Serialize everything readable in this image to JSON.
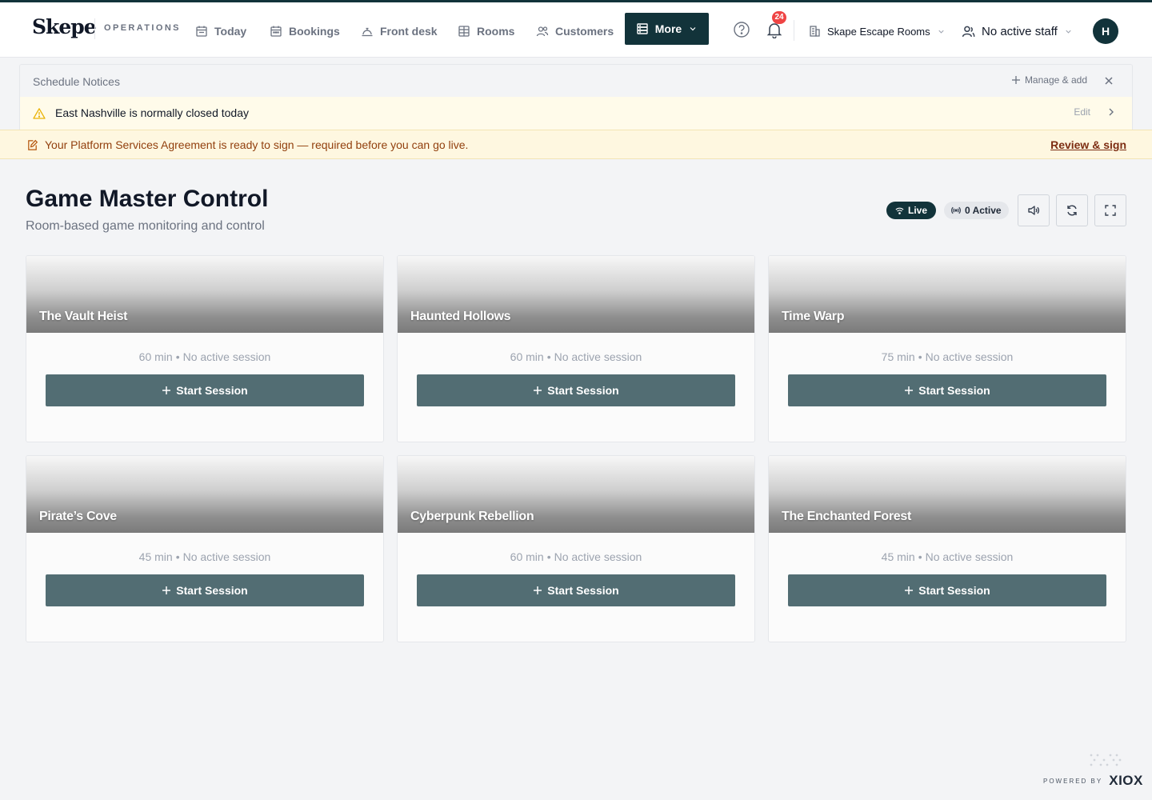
{
  "nav": {
    "logo": "Skepe",
    "section": "OPERATIONS",
    "items": [
      {
        "label": "Today",
        "icon": "calendar-day-icon"
      },
      {
        "label": "Bookings",
        "icon": "calendar-icon"
      },
      {
        "label": "Front desk",
        "icon": "bell-desk-icon"
      },
      {
        "label": "Rooms",
        "icon": "grid-icon"
      },
      {
        "label": "Customers",
        "icon": "users-icon"
      }
    ],
    "more_label": "More",
    "notification_count": "24",
    "org_name": "Skape Escape Rooms",
    "staff_label": "No active staff",
    "avatar_initial": "H"
  },
  "notices": {
    "title": "Schedule Notices",
    "manage_label": "Manage & add",
    "items": [
      {
        "text": "East Nashville is normally closed today",
        "action": "Edit"
      }
    ]
  },
  "agreement": {
    "text": "Your Platform Services Agreement is ready to sign — required before you can go live.",
    "link_label": "Review & sign"
  },
  "header": {
    "title": "Game Master Control",
    "subtitle": "Room-based game monitoring and control",
    "live_label": "Live",
    "active_label": "0 Active"
  },
  "rooms": [
    {
      "name": "The Vault Heist",
      "duration": "60 min",
      "status": "No active session",
      "button": "Start Session"
    },
    {
      "name": "Haunted Hollows",
      "duration": "60 min",
      "status": "No active session",
      "button": "Start Session"
    },
    {
      "name": "Time Warp",
      "duration": "75 min",
      "status": "No active session",
      "button": "Start Session"
    },
    {
      "name": "Pirate’s Cove",
      "duration": "45 min",
      "status": "No active session",
      "button": "Start Session"
    },
    {
      "name": "Cyberpunk Rebellion",
      "duration": "60 min",
      "status": "No active session",
      "button": "Start Session"
    },
    {
      "name": "The Enchanted Forest",
      "duration": "45 min",
      "status": "No active session",
      "button": "Start Session"
    }
  ],
  "footer": {
    "powered_label": "POWERED BY",
    "brand": "XIOX"
  },
  "colors": {
    "brand_dark": "#12333a",
    "button": "#526d73",
    "badge": "#ef4444",
    "notice_bg": "#fffbea"
  }
}
